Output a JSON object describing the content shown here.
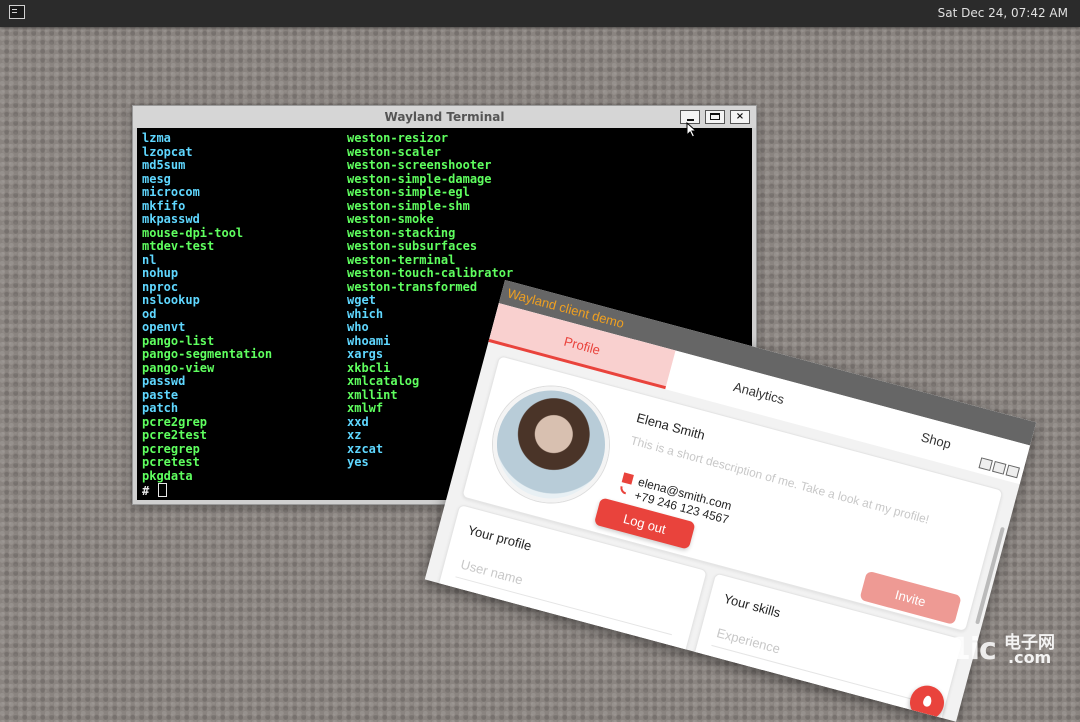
{
  "panel": {
    "launcher_icon": "terminal-icon",
    "clock": "Sat Dec 24, 07:42 AM"
  },
  "terminal": {
    "title": "Wayland Terminal",
    "buttons": {
      "minimize": "minimize-icon",
      "maximize": "maximize-icon",
      "close": "×"
    },
    "col1": [
      {
        "t": "lzma",
        "c": "cyan"
      },
      {
        "t": "lzopcat",
        "c": "cyan"
      },
      {
        "t": "md5sum",
        "c": "cyan"
      },
      {
        "t": "mesg",
        "c": "cyan"
      },
      {
        "t": "microcom",
        "c": "cyan"
      },
      {
        "t": "mkfifo",
        "c": "cyan"
      },
      {
        "t": "mkpasswd",
        "c": "cyan"
      },
      {
        "t": "mouse-dpi-tool",
        "c": "green"
      },
      {
        "t": "mtdev-test",
        "c": "green"
      },
      {
        "t": "nl",
        "c": "cyan"
      },
      {
        "t": "nohup",
        "c": "cyan"
      },
      {
        "t": "nproc",
        "c": "cyan"
      },
      {
        "t": "nslookup",
        "c": "cyan"
      },
      {
        "t": "od",
        "c": "cyan"
      },
      {
        "t": "openvt",
        "c": "cyan"
      },
      {
        "t": "pango-list",
        "c": "green"
      },
      {
        "t": "pango-segmentation",
        "c": "green"
      },
      {
        "t": "pango-view",
        "c": "green"
      },
      {
        "t": "passwd",
        "c": "cyan"
      },
      {
        "t": "paste",
        "c": "cyan"
      },
      {
        "t": "patch",
        "c": "cyan"
      },
      {
        "t": "pcre2grep",
        "c": "green"
      },
      {
        "t": "pcre2test",
        "c": "green"
      },
      {
        "t": "pcregrep",
        "c": "green"
      },
      {
        "t": "pcretest",
        "c": "green"
      },
      {
        "t": "pkgdata",
        "c": "green"
      }
    ],
    "col2": [
      {
        "t": "weston-resizor",
        "c": "green"
      },
      {
        "t": "weston-scaler",
        "c": "green"
      },
      {
        "t": "weston-screenshooter",
        "c": "green"
      },
      {
        "t": "weston-simple-damage",
        "c": "green"
      },
      {
        "t": "weston-simple-egl",
        "c": "green"
      },
      {
        "t": "weston-simple-shm",
        "c": "green"
      },
      {
        "t": "weston-smoke",
        "c": "green"
      },
      {
        "t": "weston-stacking",
        "c": "green"
      },
      {
        "t": "weston-subsurfaces",
        "c": "green"
      },
      {
        "t": "weston-terminal",
        "c": "green"
      },
      {
        "t": "weston-touch-calibrator",
        "c": "green"
      },
      {
        "t": "weston-transformed",
        "c": "green"
      },
      {
        "t": "wget",
        "c": "cyan"
      },
      {
        "t": "which",
        "c": "cyan"
      },
      {
        "t": "who",
        "c": "cyan"
      },
      {
        "t": "whoami",
        "c": "cyan"
      },
      {
        "t": "xargs",
        "c": "cyan"
      },
      {
        "t": "xkbcli",
        "c": "green"
      },
      {
        "t": "xmlcatalog",
        "c": "green"
      },
      {
        "t": "xmllint",
        "c": "green"
      },
      {
        "t": "xmlwf",
        "c": "green"
      },
      {
        "t": "xxd",
        "c": "cyan"
      },
      {
        "t": "xz",
        "c": "cyan"
      },
      {
        "t": "xzcat",
        "c": "cyan"
      },
      {
        "t": "yes",
        "c": "cyan"
      }
    ],
    "prompt": "#"
  },
  "demo": {
    "title": "Wayland client demo",
    "tabs": [
      "Profile",
      "Analytics",
      "Shop"
    ],
    "profile": {
      "name": "Elena Smith",
      "description": "This is a short description of me. Take a look at my profile!",
      "email": "elena@smith.com",
      "phone": "+79 246 123 4567",
      "logout_label": "Log out",
      "invite_label": "Invite"
    },
    "your_profile": {
      "title": "Your profile",
      "username_placeholder": "User name"
    },
    "your_skills": {
      "title": "Your skills",
      "experience_placeholder": "Experience"
    },
    "colors": {
      "accent": "#e9433c",
      "tab_active_bg": "#f9d0cf",
      "title_text": "#f0a020"
    }
  },
  "watermark": {
    "big": "21ic",
    "cn": "电子网",
    "com": ".com"
  }
}
